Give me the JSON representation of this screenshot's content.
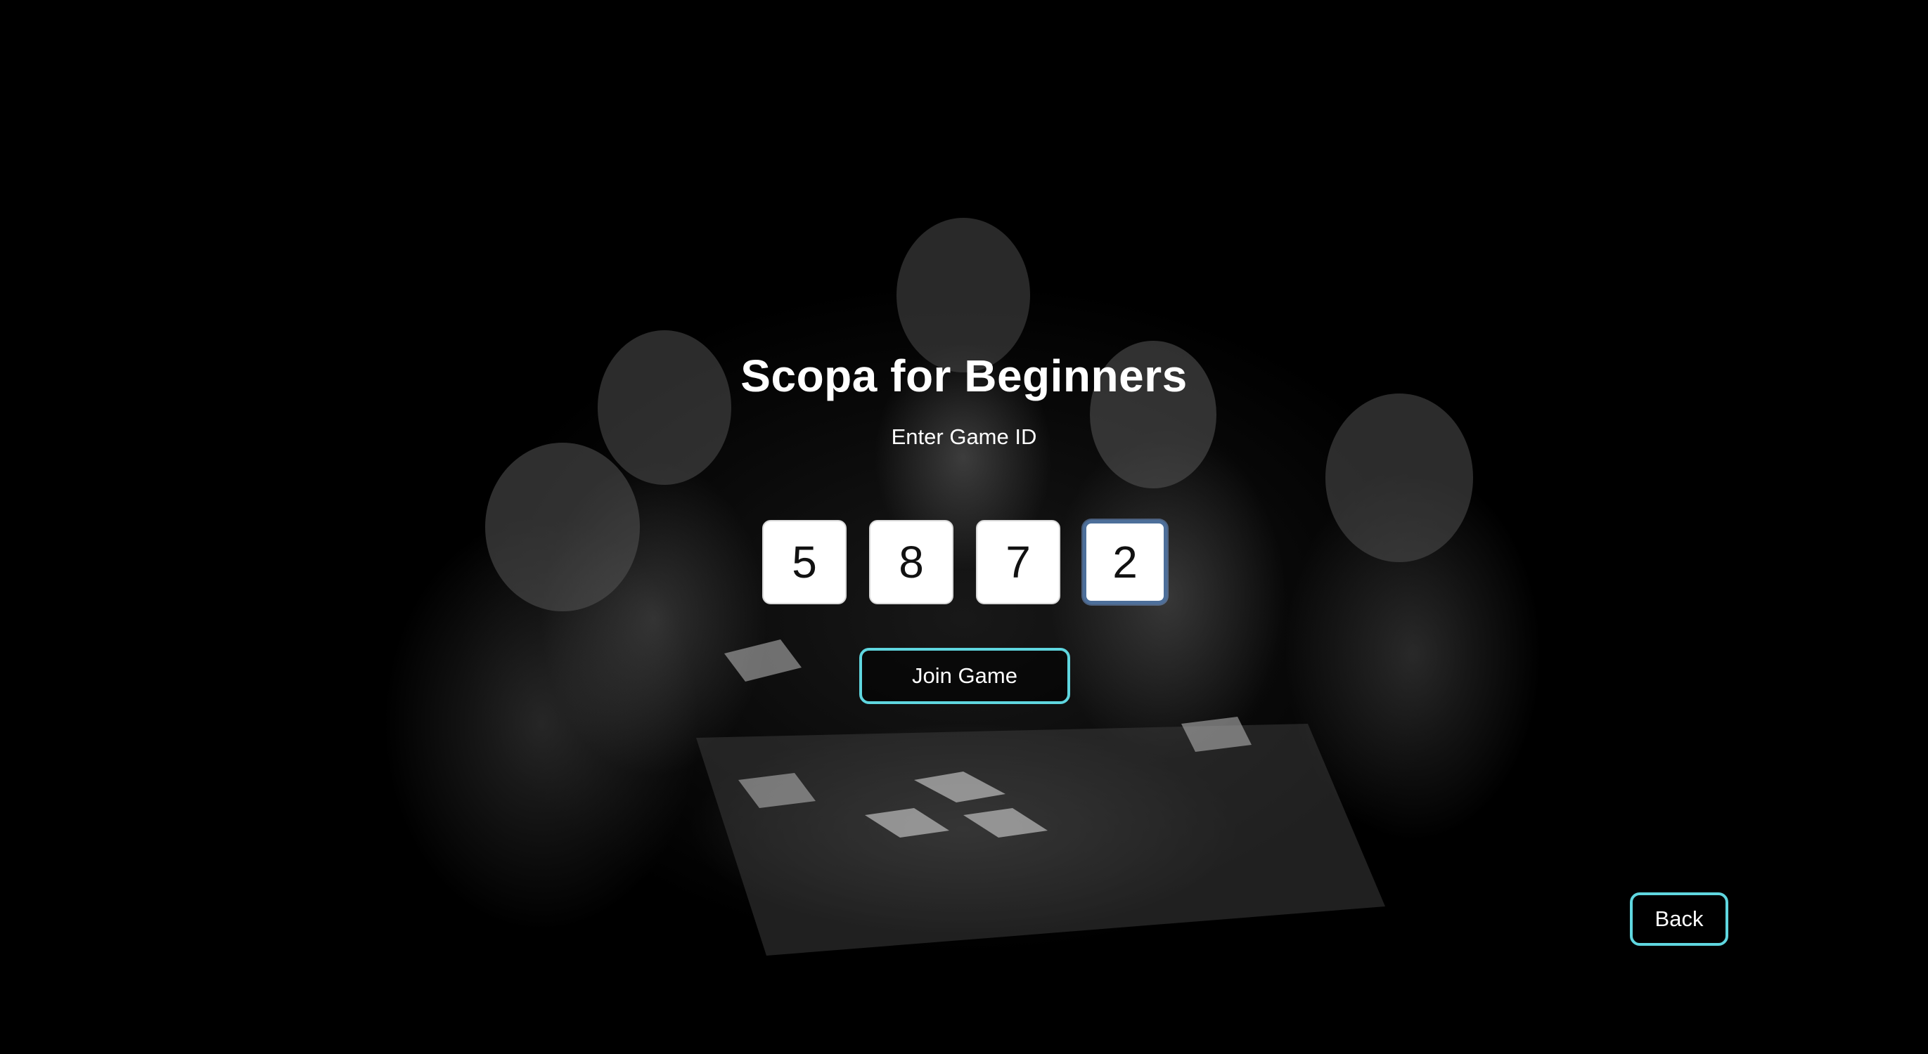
{
  "app": {
    "title": "Scopa for Beginners",
    "subtitle": "Enter Game ID"
  },
  "game_id": {
    "digits": [
      "5",
      "8",
      "7",
      "2"
    ],
    "focused_index": 3
  },
  "actions": {
    "join_label": "Join Game",
    "back_label": "Back"
  },
  "colors": {
    "background": "#000000",
    "accent_border": "#5fd6df",
    "focus_border": "#4d6f9a",
    "text": "#ffffff"
  },
  "background_art": {
    "icon": "statues-playing-cards-image"
  }
}
